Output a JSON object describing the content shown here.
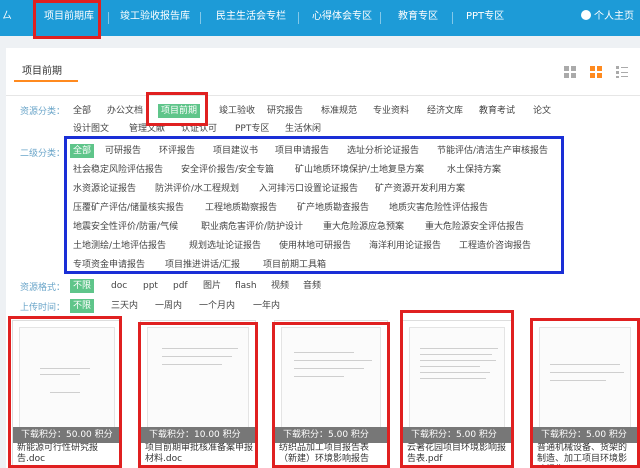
{
  "nav": {
    "left_partial": "ㄙ",
    "items": [
      "项目前期库",
      "竣工验收报告库",
      "民主生活会专栏",
      "心得体会专区",
      "教育专区",
      "PPT专区"
    ],
    "user": "个人主页"
  },
  "panel": {
    "title": "项目前期",
    "view_icons": [
      "grid-view-icon",
      "large-grid-view-icon",
      "list-view-icon"
    ]
  },
  "filters": {
    "category": {
      "label": "资源分类：",
      "row1": [
        "全部",
        "办公文档",
        "项目前期",
        "竣工验收",
        "研究报告",
        "标准规范",
        "专业资料",
        "经济文库",
        "教育考试",
        "论文"
      ],
      "row2": [
        "设计图文",
        "管理文献",
        "认证认可",
        "PPT专区",
        "生活休闲"
      ],
      "active": "项目前期"
    },
    "subcategory": {
      "label": "二级分类：",
      "rows": [
        [
          "全部",
          "可研报告",
          "环评报告",
          "项目建议书",
          "项目申请报告",
          "选址分析论证报告",
          "节能评估/清洁生产审核报告"
        ],
        [
          "社会稳定风险评估报告",
          "安全评价报告/安全专篇",
          "矿山地质环境保护/土地复垦方案",
          "水土保持方案"
        ],
        [
          "水资源论证报告",
          "防洪评价/水工程规划",
          "入河排污口设置论证报告",
          "矿产资源开发利用方案"
        ],
        [
          "压覆矿产评估/储量核实报告",
          "工程地质勘察报告",
          "矿产地质勘查报告",
          "地质灾害危险性评估报告"
        ],
        [
          "地震安全性评价/防雷/气候",
          "职业病危害评价/防护设计",
          "重大危险源应急预案",
          "重大危险源安全评估报告"
        ],
        [
          "土地测绘/土地评估报告",
          "规划选址论证报告",
          "使用林地可研报告",
          "海洋利用论证报告",
          "工程造价咨询报告"
        ],
        [
          "专项资金申请报告",
          "项目推进讲话/汇报",
          "项目前期工具箱"
        ]
      ],
      "active": "全部"
    },
    "format": {
      "label": "资源格式：",
      "items": [
        "不限",
        "doc",
        "ppt",
        "pdf",
        "图片",
        "flash",
        "视频",
        "音频"
      ],
      "active": "不限"
    },
    "time": {
      "label": "上传时间：",
      "items": [
        "不限",
        "三天内",
        "一周内",
        "一个月内",
        "一年内"
      ],
      "active": "不限"
    }
  },
  "documents": [
    {
      "price": "下载积分：50.00 积分",
      "title": "新能源可行性研究报告.doc"
    },
    {
      "price": "下载积分：10.00 积分",
      "title": "项目前期审批核准备案申报材料.doc"
    },
    {
      "price": "下载积分：5.00 积分",
      "title": "纺织品加工项目报告表（新建）环境影响报告"
    },
    {
      "price": "下载积分：5.00 积分",
      "title": "云著花园项目环境影响报告表.pdf"
    },
    {
      "price": "下载积分：5.00 积分",
      "title": "普通机械设备、货架的制造、加工项目环境影响报告"
    }
  ],
  "colors": {
    "nav": "#1d9bd7",
    "active": "#5fc58a",
    "accent": "#ff8a1f",
    "red_highlight": "#e02020",
    "blue_highlight": "#1a2fd6"
  }
}
